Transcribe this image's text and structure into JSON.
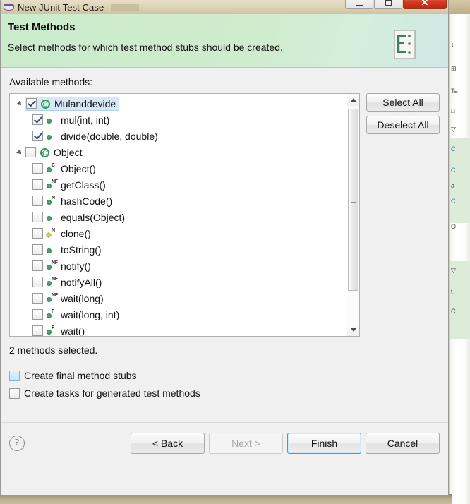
{
  "window": {
    "title": "New JUnit Test Case",
    "title_icon": "junit-disk-icon",
    "controls": {
      "minimize": "minimize-icon",
      "maximize": "maximize-icon",
      "close": "✕"
    }
  },
  "banner": {
    "title": "Test Methods",
    "description": "Select methods for which test method stubs should be created.",
    "icon": "test-methods-wizard-icon",
    "bg_color": "#cfeccd"
  },
  "main": {
    "available_label": "Available methods:",
    "tree": [
      {
        "level": 0,
        "twisty": true,
        "checked": true,
        "selected": true,
        "icon": "class-icon",
        "modifier": "",
        "label": "Mulanddevide"
      },
      {
        "level": 1,
        "twisty": false,
        "checked": true,
        "selected": false,
        "icon": "method-icon",
        "modifier": "",
        "label": "mul(int, int)"
      },
      {
        "level": 1,
        "twisty": false,
        "checked": true,
        "selected": false,
        "icon": "method-icon",
        "modifier": "",
        "label": "divide(double, double)"
      },
      {
        "level": 0,
        "twisty": true,
        "checked": false,
        "selected": false,
        "icon": "class-icon",
        "modifier": "",
        "label": "Object"
      },
      {
        "level": 1,
        "twisty": false,
        "checked": false,
        "selected": false,
        "icon": "method-icon",
        "modifier": "C",
        "label": "Object()"
      },
      {
        "level": 1,
        "twisty": false,
        "checked": false,
        "selected": false,
        "icon": "method-icon",
        "modifier": "NF",
        "label": "getClass()"
      },
      {
        "level": 1,
        "twisty": false,
        "checked": false,
        "selected": false,
        "icon": "method-icon",
        "modifier": "N",
        "label": "hashCode()"
      },
      {
        "level": 1,
        "twisty": false,
        "checked": false,
        "selected": false,
        "icon": "method-icon",
        "modifier": "",
        "label": "equals(Object)"
      },
      {
        "level": 1,
        "twisty": false,
        "checked": false,
        "selected": false,
        "icon": "method-protected-icon",
        "modifier": "N",
        "label": "clone()"
      },
      {
        "level": 1,
        "twisty": false,
        "checked": false,
        "selected": false,
        "icon": "method-icon",
        "modifier": "",
        "label": "toString()"
      },
      {
        "level": 1,
        "twisty": false,
        "checked": false,
        "selected": false,
        "icon": "method-icon",
        "modifier": "NF",
        "label": "notify()"
      },
      {
        "level": 1,
        "twisty": false,
        "checked": false,
        "selected": false,
        "icon": "method-icon",
        "modifier": "NF",
        "label": "notifyAll()"
      },
      {
        "level": 1,
        "twisty": false,
        "checked": false,
        "selected": false,
        "icon": "method-icon",
        "modifier": "NF",
        "label": "wait(long)"
      },
      {
        "level": 1,
        "twisty": false,
        "checked": false,
        "selected": false,
        "icon": "method-icon",
        "modifier": "F",
        "label": "wait(long, int)"
      },
      {
        "level": 1,
        "twisty": false,
        "checked": false,
        "selected": false,
        "icon": "method-icon",
        "modifier": "F",
        "label": "wait()"
      }
    ],
    "side_buttons": {
      "select_all": "Select All",
      "deselect_all": "Deselect All"
    },
    "status": "2 methods selected.",
    "options": [
      {
        "label": "Create final method stubs",
        "checked": false,
        "hover": true
      },
      {
        "label": "Create tasks for generated test methods",
        "checked": false,
        "hover": false
      }
    ]
  },
  "footer": {
    "help_icon": "?",
    "buttons": {
      "back": "< Back",
      "next": "Next >",
      "finish": "Finish",
      "cancel": "Cancel"
    }
  },
  "background": {
    "view_rows": [
      {
        "text": "↓",
        "link": false
      },
      {
        "text": "⊞",
        "link": false
      },
      {
        "text": "Ta",
        "link": false
      },
      {
        "text": "□",
        "link": false
      },
      {
        "text": "▽",
        "link": false
      },
      {
        "text": "C",
        "link": true
      },
      {
        "text": "C",
        "link": true
      },
      {
        "text": "a",
        "link": false
      },
      {
        "text": "C",
        "link": true
      },
      {
        "text": "O",
        "link": false
      },
      {
        "text": "▽",
        "link": false
      },
      {
        "text": "t",
        "link": false
      },
      {
        "text": "C",
        "link": false
      }
    ]
  }
}
